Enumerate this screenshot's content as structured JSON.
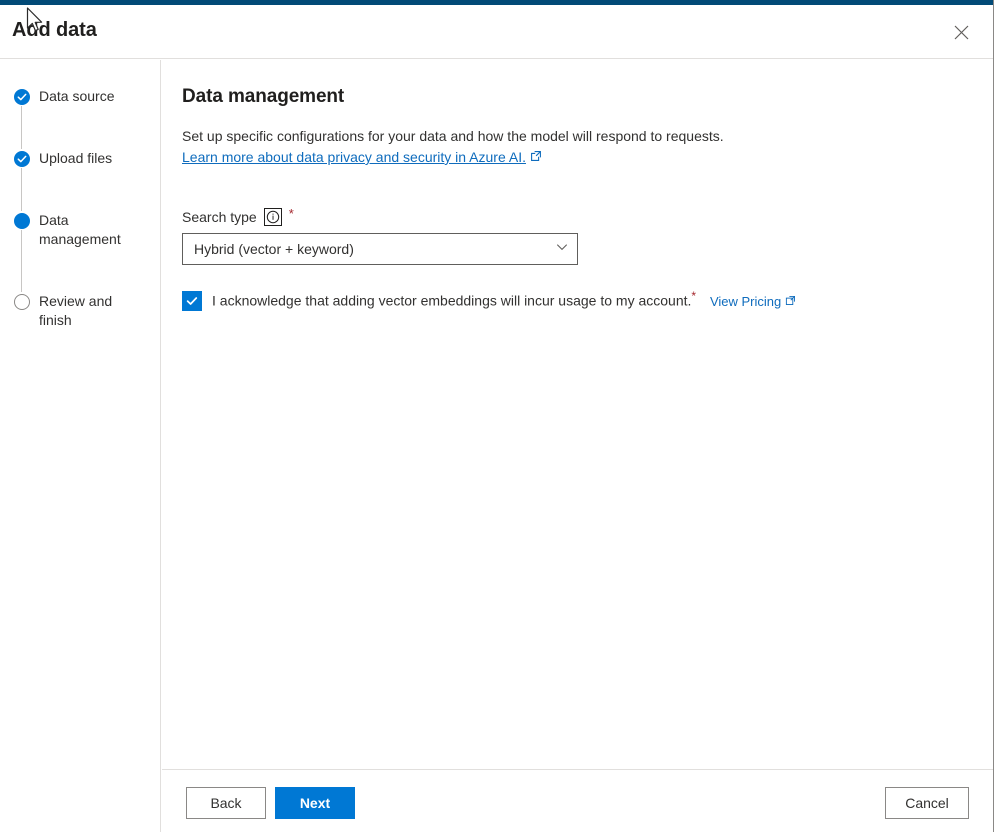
{
  "accent_color": "#0078d4",
  "top_bar_color": "#024A77",
  "header": {
    "title": "Add data",
    "close_icon": "close-icon"
  },
  "steps": [
    {
      "label": "Data source",
      "state": "done",
      "icon": "check-circle-icon"
    },
    {
      "label": "Upload files",
      "state": "done",
      "icon": "check-circle-icon"
    },
    {
      "label": "Data management",
      "state": "current",
      "icon": "filled-circle-icon"
    },
    {
      "label": "Review and finish",
      "state": "pending",
      "icon": "empty-circle-icon"
    }
  ],
  "main": {
    "section_title": "Data management",
    "description": "Set up specific configurations for your data and how the model will respond to requests.",
    "learn_more_link": "Learn more about data privacy and security in Azure AI.",
    "search_type": {
      "label": "Search type",
      "info_icon": "info-icon",
      "required_marker": "*",
      "selected_value": "Hybrid (vector + keyword)",
      "chevron_icon": "chevron-down-icon"
    },
    "acknowledgement": {
      "checked": true,
      "text": "I acknowledge that adding vector embeddings will incur usage to my account.",
      "required_marker": "*",
      "pricing_link": "View Pricing",
      "external_icon": "external-link-icon"
    }
  },
  "footer": {
    "back_label": "Back",
    "next_label": "Next",
    "cancel_label": "Cancel"
  }
}
